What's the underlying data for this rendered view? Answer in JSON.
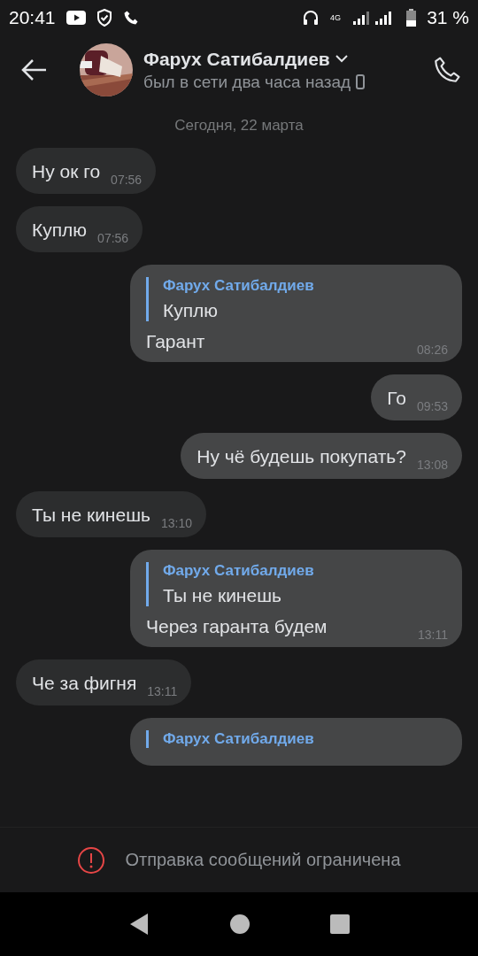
{
  "status_bar": {
    "time": "20:41",
    "network": "4G",
    "battery": "31 %"
  },
  "header": {
    "name": "Фарух Сатибалдиев",
    "status": "был в сети два часа назад"
  },
  "date_divider": "Сегодня, 22 марта",
  "messages": [
    {
      "kind": "incoming",
      "text": "Ну ок го",
      "time": "07:56"
    },
    {
      "kind": "incoming",
      "text": "Куплю",
      "time": "07:56"
    },
    {
      "kind": "outgoing",
      "reply": {
        "author": "Фарух Сатибалдиев",
        "text": "Куплю"
      },
      "text": "Гарант",
      "time": "08:26"
    },
    {
      "kind": "outgoing",
      "text": "Го",
      "time": "09:53"
    },
    {
      "kind": "outgoing",
      "text": "Ну чё будешь покупать?",
      "time": "13:08"
    },
    {
      "kind": "incoming",
      "text": "Ты не кинешь",
      "time": "13:10"
    },
    {
      "kind": "outgoing",
      "reply": {
        "author": "Фарух Сатибалдиев",
        "text": "Ты не кинешь"
      },
      "text": "Через гаранта будем",
      "time": "13:11"
    },
    {
      "kind": "incoming",
      "text": "Че за фигня",
      "time": "13:11"
    },
    {
      "kind": "outgoing",
      "reply": {
        "author": "Фарух Сатибалдиев"
      }
    }
  ],
  "notice": "Отправка сообщений ограничена"
}
